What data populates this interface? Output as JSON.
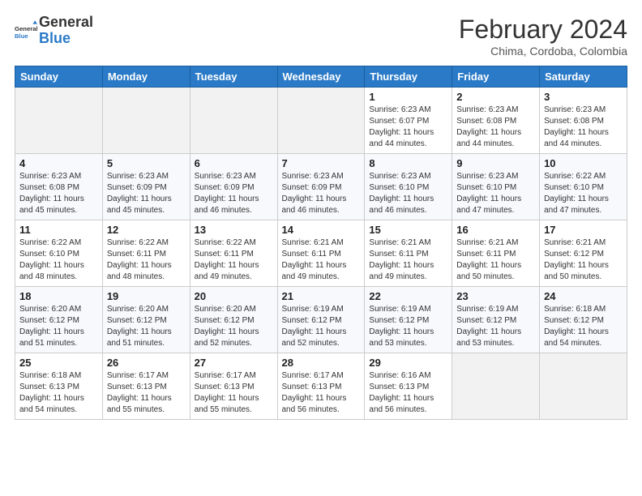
{
  "logo": {
    "text_general": "General",
    "text_blue": "Blue"
  },
  "header": {
    "month_year": "February 2024",
    "location": "Chima, Cordoba, Colombia"
  },
  "days_of_week": [
    "Sunday",
    "Monday",
    "Tuesday",
    "Wednesday",
    "Thursday",
    "Friday",
    "Saturday"
  ],
  "weeks": [
    [
      {
        "day": "",
        "empty": true
      },
      {
        "day": "",
        "empty": true
      },
      {
        "day": "",
        "empty": true
      },
      {
        "day": "",
        "empty": true
      },
      {
        "day": "1",
        "sunrise": "6:23 AM",
        "sunset": "6:07 PM",
        "daylight": "11 hours and 44 minutes."
      },
      {
        "day": "2",
        "sunrise": "6:23 AM",
        "sunset": "6:08 PM",
        "daylight": "11 hours and 44 minutes."
      },
      {
        "day": "3",
        "sunrise": "6:23 AM",
        "sunset": "6:08 PM",
        "daylight": "11 hours and 44 minutes."
      }
    ],
    [
      {
        "day": "4",
        "sunrise": "6:23 AM",
        "sunset": "6:08 PM",
        "daylight": "11 hours and 45 minutes."
      },
      {
        "day": "5",
        "sunrise": "6:23 AM",
        "sunset": "6:09 PM",
        "daylight": "11 hours and 45 minutes."
      },
      {
        "day": "6",
        "sunrise": "6:23 AM",
        "sunset": "6:09 PM",
        "daylight": "11 hours and 46 minutes."
      },
      {
        "day": "7",
        "sunrise": "6:23 AM",
        "sunset": "6:09 PM",
        "daylight": "11 hours and 46 minutes."
      },
      {
        "day": "8",
        "sunrise": "6:23 AM",
        "sunset": "6:10 PM",
        "daylight": "11 hours and 46 minutes."
      },
      {
        "day": "9",
        "sunrise": "6:23 AM",
        "sunset": "6:10 PM",
        "daylight": "11 hours and 47 minutes."
      },
      {
        "day": "10",
        "sunrise": "6:22 AM",
        "sunset": "6:10 PM",
        "daylight": "11 hours and 47 minutes."
      }
    ],
    [
      {
        "day": "11",
        "sunrise": "6:22 AM",
        "sunset": "6:10 PM",
        "daylight": "11 hours and 48 minutes."
      },
      {
        "day": "12",
        "sunrise": "6:22 AM",
        "sunset": "6:11 PM",
        "daylight": "11 hours and 48 minutes."
      },
      {
        "day": "13",
        "sunrise": "6:22 AM",
        "sunset": "6:11 PM",
        "daylight": "11 hours and 49 minutes."
      },
      {
        "day": "14",
        "sunrise": "6:21 AM",
        "sunset": "6:11 PM",
        "daylight": "11 hours and 49 minutes."
      },
      {
        "day": "15",
        "sunrise": "6:21 AM",
        "sunset": "6:11 PM",
        "daylight": "11 hours and 49 minutes."
      },
      {
        "day": "16",
        "sunrise": "6:21 AM",
        "sunset": "6:11 PM",
        "daylight": "11 hours and 50 minutes."
      },
      {
        "day": "17",
        "sunrise": "6:21 AM",
        "sunset": "6:12 PM",
        "daylight": "11 hours and 50 minutes."
      }
    ],
    [
      {
        "day": "18",
        "sunrise": "6:20 AM",
        "sunset": "6:12 PM",
        "daylight": "11 hours and 51 minutes."
      },
      {
        "day": "19",
        "sunrise": "6:20 AM",
        "sunset": "6:12 PM",
        "daylight": "11 hours and 51 minutes."
      },
      {
        "day": "20",
        "sunrise": "6:20 AM",
        "sunset": "6:12 PM",
        "daylight": "11 hours and 52 minutes."
      },
      {
        "day": "21",
        "sunrise": "6:19 AM",
        "sunset": "6:12 PM",
        "daylight": "11 hours and 52 minutes."
      },
      {
        "day": "22",
        "sunrise": "6:19 AM",
        "sunset": "6:12 PM",
        "daylight": "11 hours and 53 minutes."
      },
      {
        "day": "23",
        "sunrise": "6:19 AM",
        "sunset": "6:12 PM",
        "daylight": "11 hours and 53 minutes."
      },
      {
        "day": "24",
        "sunrise": "6:18 AM",
        "sunset": "6:12 PM",
        "daylight": "11 hours and 54 minutes."
      }
    ],
    [
      {
        "day": "25",
        "sunrise": "6:18 AM",
        "sunset": "6:13 PM",
        "daylight": "11 hours and 54 minutes."
      },
      {
        "day": "26",
        "sunrise": "6:17 AM",
        "sunset": "6:13 PM",
        "daylight": "11 hours and 55 minutes."
      },
      {
        "day": "27",
        "sunrise": "6:17 AM",
        "sunset": "6:13 PM",
        "daylight": "11 hours and 55 minutes."
      },
      {
        "day": "28",
        "sunrise": "6:17 AM",
        "sunset": "6:13 PM",
        "daylight": "11 hours and 56 minutes."
      },
      {
        "day": "29",
        "sunrise": "6:16 AM",
        "sunset": "6:13 PM",
        "daylight": "11 hours and 56 minutes."
      },
      {
        "day": "",
        "empty": true
      },
      {
        "day": "",
        "empty": true
      }
    ]
  ]
}
